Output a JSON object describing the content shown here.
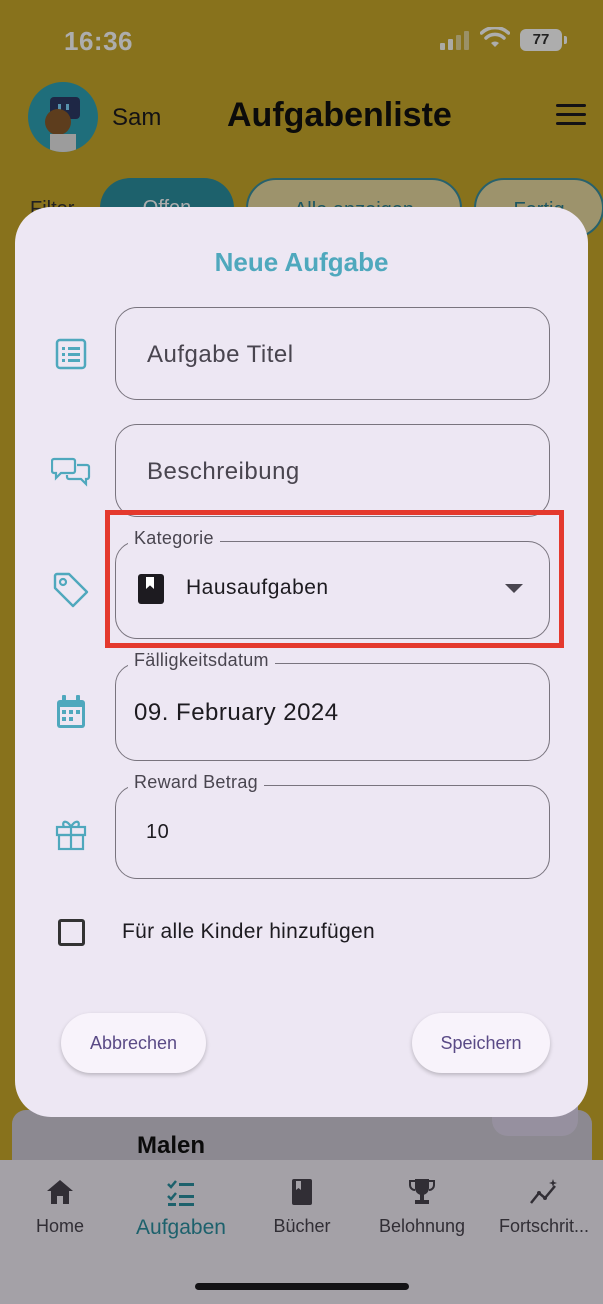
{
  "status_bar": {
    "time": "16:36",
    "battery": "77"
  },
  "app_bar": {
    "username": "Sam",
    "title": "Aufgabenliste"
  },
  "filter": {
    "label": "Filter",
    "chips": [
      "Offen",
      "Alle anzeigen",
      "Fertig"
    ]
  },
  "background_card": {
    "title": "Malen"
  },
  "dialog": {
    "title": "Neue Aufgabe",
    "title_field": {
      "placeholder": "Aufgabe Titel"
    },
    "description_field": {
      "placeholder": "Beschreibung"
    },
    "category_field": {
      "label": "Kategorie",
      "value": "Hausaufgaben"
    },
    "due_date_field": {
      "label": "Fälligkeitsdatum",
      "value": "09. February 2024"
    },
    "reward_field": {
      "label": "Reward Betrag",
      "value": "10"
    },
    "all_children_checkbox": {
      "label": "Für alle Kinder hinzufügen",
      "checked": false
    },
    "cancel_button": "Abbrechen",
    "save_button": "Speichern"
  },
  "bottom_nav": {
    "items": [
      {
        "label": "Home",
        "icon": "home-icon"
      },
      {
        "label": "Aufgaben",
        "icon": "task-list-icon",
        "active": true
      },
      {
        "label": "Bücher",
        "icon": "book-icon"
      },
      {
        "label": "Belohnung",
        "icon": "trophy-icon"
      },
      {
        "label": "Fortschrit...",
        "icon": "progress-chart-icon"
      }
    ]
  },
  "colors": {
    "accent": "#4fa8bd",
    "app_background": "#c9a92a",
    "dialog_background": "#ede7f3",
    "highlight": "#e4392d",
    "button_text": "#5a4a86"
  }
}
